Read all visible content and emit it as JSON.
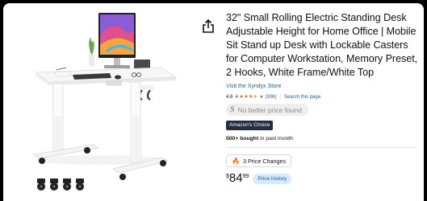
{
  "product": {
    "title": "32\" Small Rolling Electric Standing Desk Adjustable Height for Home Office | Mobile Sit Stand up Desk with Lockable Casters for Computer Workstation, Memory Preset, 2 Hooks, White Frame/White Top",
    "store_link": "Visit the Xyndyx Store",
    "rating": "4.6",
    "rating_stars": 4.5,
    "rating_count": "(306)",
    "separator": "|",
    "search_link": "Search this page",
    "price_tool_logo": "S",
    "price_tool_text": "No better price found",
    "badge": "Amazon's Choice",
    "bought_bold": "500+ bought",
    "bought_rest": " in past month",
    "price_changes": "3 Price Changes",
    "price_currency": "$",
    "price_whole": "84",
    "price_fraction": "99",
    "price_history": "Price history"
  },
  "icons": {
    "share": "share-icon",
    "star": "star-icon",
    "flame": "flame-icon"
  },
  "colors": {
    "link": "#2162a1",
    "star": "#de7921",
    "badge_bg": "#232f3e",
    "history_bg": "#d7e9fb"
  }
}
